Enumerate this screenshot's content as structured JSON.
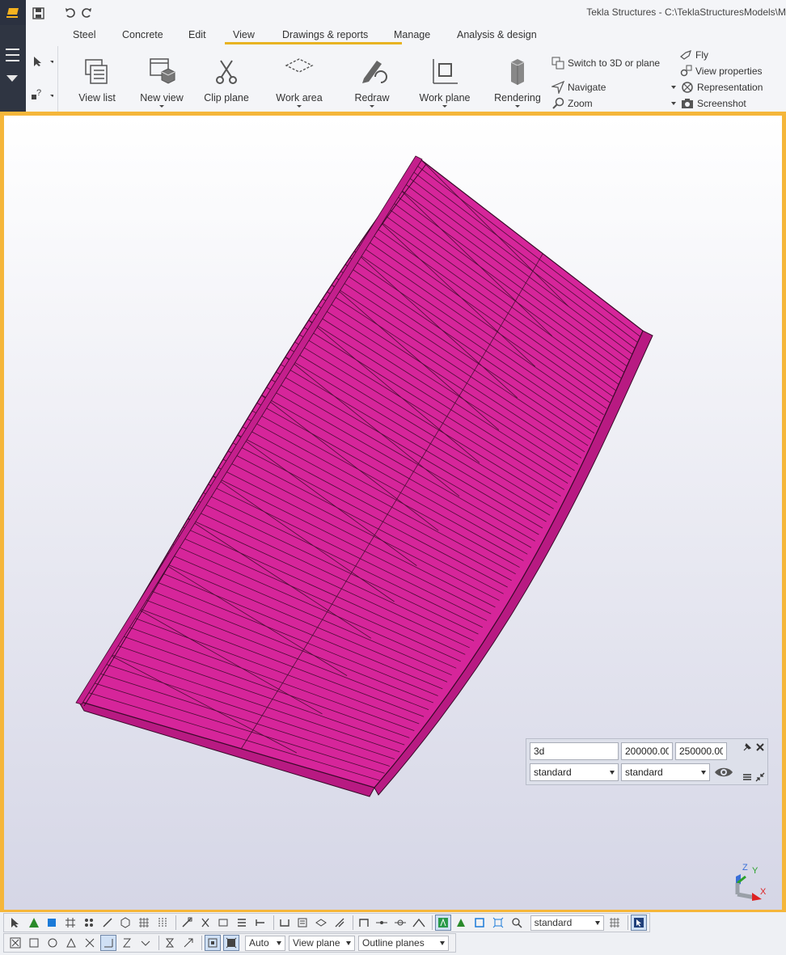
{
  "window": {
    "title": "Tekla Structures - C:\\TeklaStructuresModels\\M"
  },
  "quick_access": {
    "icons": [
      "logo-icon",
      "save-icon",
      "undo-icon",
      "redo-icon"
    ]
  },
  "tabs": [
    {
      "label": "Steel"
    },
    {
      "label": "Concrete"
    },
    {
      "label": "Edit"
    },
    {
      "label": "View"
    },
    {
      "label": "Drawings & reports"
    },
    {
      "label": "Manage"
    },
    {
      "label": "Analysis & design"
    }
  ],
  "active_tab": "View",
  "ribbon": {
    "buttons": [
      {
        "label": "View list"
      },
      {
        "label": "New view"
      },
      {
        "label": "Clip plane"
      },
      {
        "label": "Work area"
      },
      {
        "label": "Redraw"
      },
      {
        "label": "Work plane"
      },
      {
        "label": "Rendering"
      }
    ],
    "small_left": [
      {
        "label": "Switch to 3D or plane"
      },
      {
        "label": "Navigate"
      },
      {
        "label": "Zoom"
      }
    ],
    "small_right": [
      {
        "label": "Fly"
      },
      {
        "label": "View properties"
      },
      {
        "label": "Representation"
      },
      {
        "label": "Screenshot"
      }
    ]
  },
  "view_box": {
    "view_name": "3d",
    "value_1": "200000.00",
    "value_2": "250000.00",
    "select_1": "standard",
    "select_2": "standard"
  },
  "axes": {
    "z": "Z",
    "y": "Y",
    "x": "X"
  },
  "bottom_toolbar": {
    "select_standard": "standard",
    "snap_mode": "Auto",
    "plane_mode": "View plane",
    "outline_mode": "Outline planes"
  },
  "colors": {
    "accent": "#e8b322",
    "viewport_border": "#f5b63a",
    "model": "#d6259a",
    "sidepanel": "#2f3542"
  }
}
